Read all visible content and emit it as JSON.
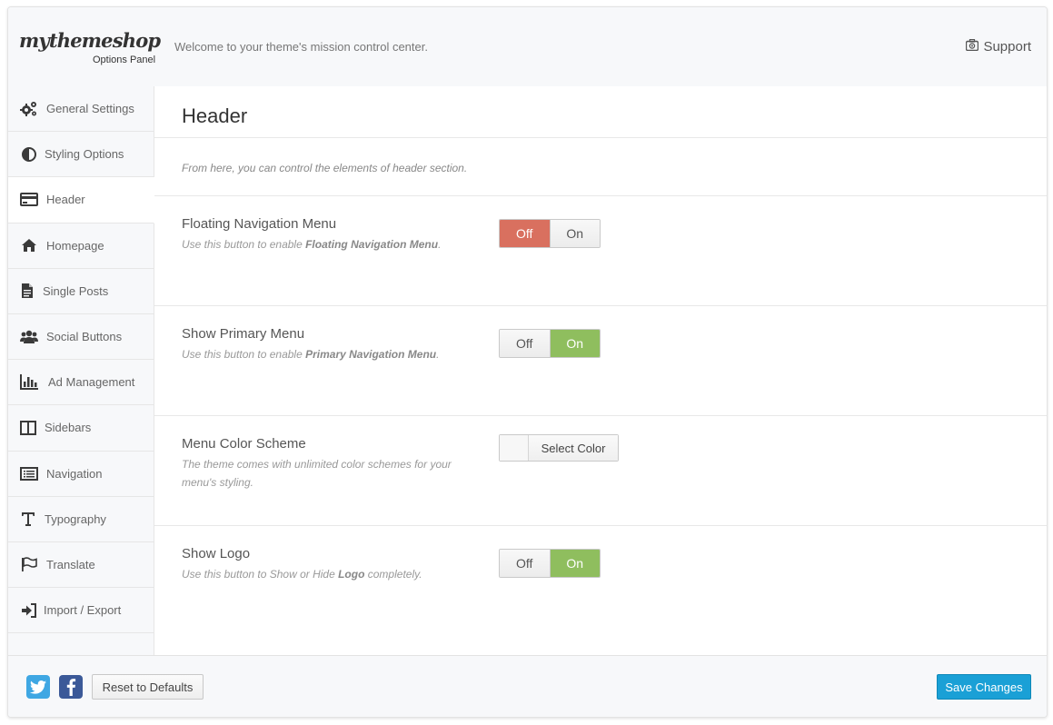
{
  "header": {
    "logo": "mythemeshop",
    "logo_sub": "Options Panel",
    "welcome": "Welcome to your theme's mission control center.",
    "support_label": "Support",
    "support_icon": "lifebuoy-briefcase-icon"
  },
  "sidebar": {
    "items": [
      {
        "label": "General Settings",
        "icon": "gears-icon"
      },
      {
        "label": "Styling Options",
        "icon": "contrast-icon"
      },
      {
        "label": "Header",
        "icon": "credit-card-icon",
        "active": true
      },
      {
        "label": "Homepage",
        "icon": "home-icon"
      },
      {
        "label": "Single Posts",
        "icon": "document-icon"
      },
      {
        "label": "Social Buttons",
        "icon": "users-icon"
      },
      {
        "label": "Ad Management",
        "icon": "bar-chart-icon"
      },
      {
        "label": "Sidebars",
        "icon": "columns-icon"
      },
      {
        "label": "Navigation",
        "icon": "list-icon"
      },
      {
        "label": "Typography",
        "icon": "text-icon"
      },
      {
        "label": "Translate",
        "icon": "flag-icon"
      },
      {
        "label": "Import / Export",
        "icon": "sign-in-icon"
      }
    ]
  },
  "main": {
    "title": "Header",
    "description": "From here, you can control the elements of header section.",
    "options": [
      {
        "title": "Floating Navigation Menu",
        "help_pre": "Use this button to enable ",
        "help_bold": "Floating Navigation Menu",
        "help_post": ".",
        "type": "toggle",
        "off_label": "Off",
        "on_label": "On",
        "value": "Off"
      },
      {
        "title": "Show Primary Menu",
        "help_pre": "Use this button to enable ",
        "help_bold": "Primary Navigation Menu",
        "help_post": ".",
        "type": "toggle",
        "off_label": "Off",
        "on_label": "On",
        "value": "On"
      },
      {
        "title": "Menu Color Scheme",
        "help_pre": "The theme comes with unlimited color schemes for your menu's styling.",
        "help_bold": "",
        "help_post": "",
        "type": "color",
        "button_label": "Select Color"
      },
      {
        "title": "Show Logo",
        "help_pre": "Use this button to Show or Hide ",
        "help_bold": "Logo",
        "help_post": " completely.",
        "type": "toggle",
        "off_label": "Off",
        "on_label": "On",
        "value": "On"
      }
    ]
  },
  "footer": {
    "twitter_icon": "twitter-icon",
    "facebook_icon": "facebook-icon",
    "reset_label": "Reset to Defaults",
    "save_label": "Save Changes"
  },
  "colors": {
    "off_active": "#d9705f",
    "on_active": "#8fbe5e",
    "save_button": "#1aa0d6",
    "twitter": "#3fa7e3",
    "facebook": "#3b5998"
  }
}
